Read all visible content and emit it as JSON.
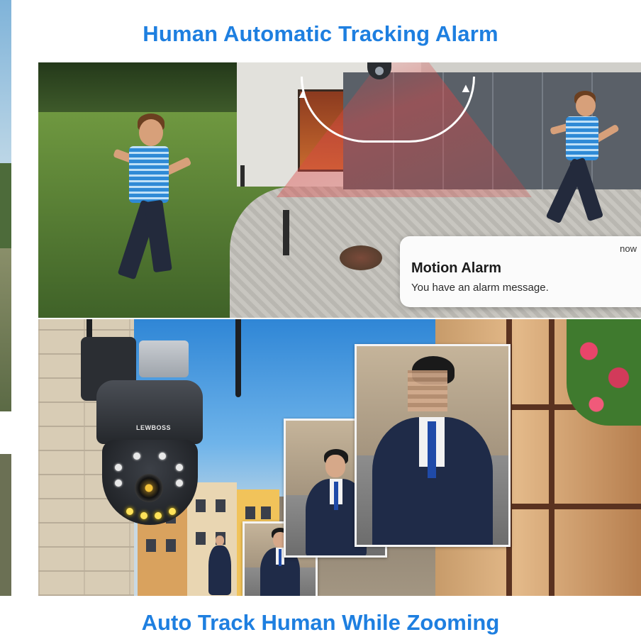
{
  "headline_top": "Human Automatic Tracking Alarm",
  "headline_bottom": "Auto Track Human While Zooming",
  "notification": {
    "time": "now",
    "title": "Motion Alarm",
    "body": "You have an alarm message."
  },
  "camera": {
    "brand": "LEWBOSS"
  },
  "colors": {
    "headline": "#1e7fe0",
    "beam": "#dc4646",
    "notification_bg": "#fbfbfb"
  }
}
